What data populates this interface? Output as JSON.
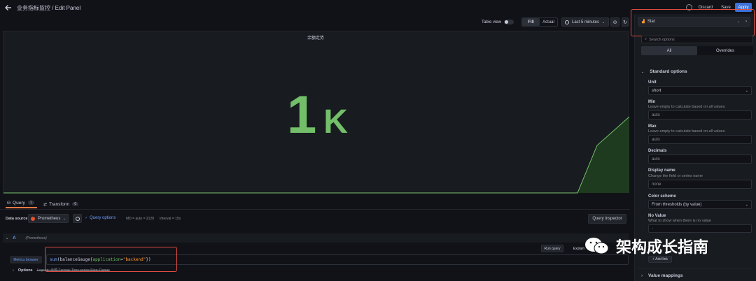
{
  "header": {
    "title": "业务指标监控 / Edit Panel",
    "discard": "Discard",
    "save": "Save",
    "apply": "Apply"
  },
  "toolbar": {
    "table_view": "Table view",
    "fill": "Fill",
    "actual": "Actual",
    "time_range": "Last 5 minutes"
  },
  "panel": {
    "title": "余额走势",
    "stat_value": "1",
    "stat_unit": "K",
    "value_color": "#73bf69"
  },
  "query_tabs": {
    "query": "Query",
    "query_count": "1",
    "transform": "Transform",
    "transform_count": "0"
  },
  "datasource": {
    "label": "Data source",
    "name": "Prometheus",
    "query_options": "Query options",
    "md": "MD = auto = 2128",
    "interval": "Interval = 15s",
    "query_inspector": "Query inspector"
  },
  "query_row": {
    "ref": "A",
    "source": "(Prometheus)",
    "run_query": "Run query",
    "explain": "Explain",
    "metrics_browser": "Metrics browser",
    "expr": "sum(balanceGauge{application=\"backend\"})",
    "options": "Options",
    "options_summary": "Legend: 余额  Format: Time series  Step: Range"
  },
  "right_panel": {
    "viz_name": "Stat",
    "search_placeholder": "Search options",
    "tab_all": "All",
    "tab_overrides": "Overrides",
    "standard_options": "Standard options",
    "unit_label": "Unit",
    "unit_value": "short",
    "min_label": "Min",
    "min_desc": "Leave empty to calculate based on all values",
    "min_value": "auto",
    "max_label": "Max",
    "max_desc": "Leave empty to calculate based on all values",
    "max_value": "auto",
    "decimals_label": "Decimals",
    "decimals_value": "auto",
    "display_name_label": "Display name",
    "display_name_desc": "Change the field or series name",
    "display_name_value": "none",
    "color_scheme_label": "Color scheme",
    "color_scheme_value": "From thresholds (by value)",
    "no_value_label": "No Value",
    "no_value_desc": "What to show when there is no value",
    "no_value_value": "-",
    "add_link": "+ Add link",
    "value_mappings": "Value mappings"
  },
  "watermark": "架构成长指南",
  "colors": {
    "accent": "#3d71d9",
    "highlight": "#e24d42",
    "sparkline": "#73bf69"
  }
}
